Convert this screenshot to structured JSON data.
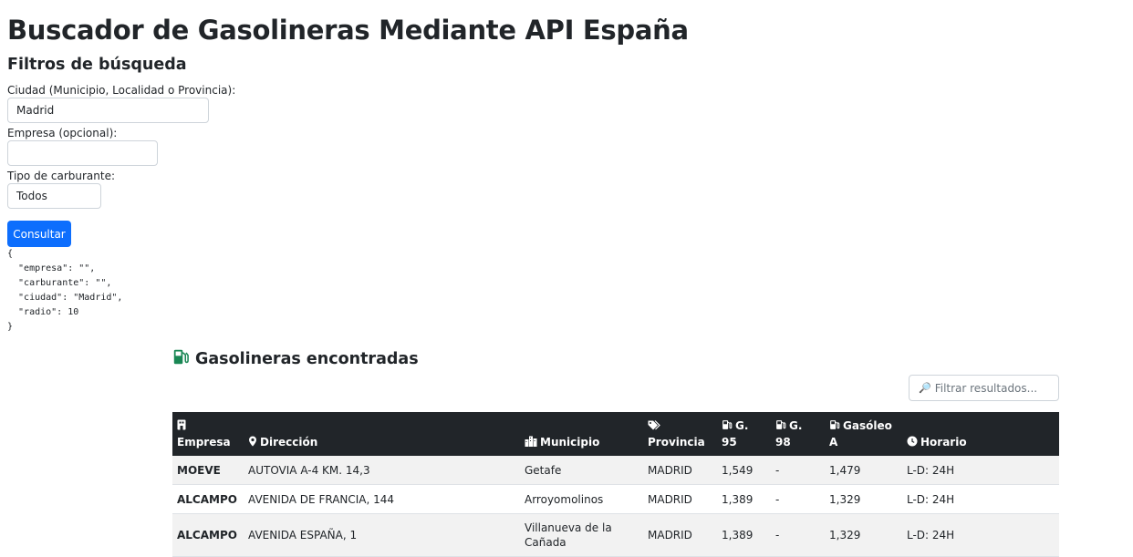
{
  "page_title": "Buscador de Gasolineras Mediante API España",
  "filters": {
    "title": "Filtros de búsqueda",
    "city_label": "Ciudad (Municipio, Localidad o Provincia):",
    "city_value": "Madrid",
    "company_label": "Empresa (opcional):",
    "company_value": "",
    "fuel_label": "Tipo de carburante:",
    "fuel_value": "Todos",
    "submit_label": "Consultar"
  },
  "request_json": "{\n  \"empresa\": \"\",\n  \"carburante\": \"\",\n  \"ciudad\": \"Madrid\",\n  \"radio\": 10\n}",
  "results": {
    "title": "Gasolineras encontradas",
    "filter_placeholder": "Filtrar resultados...",
    "columns": {
      "empresa": "Empresa",
      "direccion": "Dirección",
      "municipio": "Municipio",
      "provincia": "Provincia",
      "g95": "G. 95",
      "g98": "G. 98",
      "gasoleo": "Gasóleo A",
      "horario": "Horario"
    },
    "rows": [
      {
        "empresa": "MOEVE",
        "direccion": "AUTOVIA A-4 KM. 14,3",
        "municipio": "Getafe",
        "provincia": "MADRID",
        "g95": "1,549",
        "g98": "-",
        "gasoleo": "1,479",
        "horario": "L-D: 24H"
      },
      {
        "empresa": "ALCAMPO",
        "direccion": "AVENIDA DE FRANCIA, 144",
        "municipio": "Arroyomolinos",
        "provincia": "MADRID",
        "g95": "1,389",
        "g98": "-",
        "gasoleo": "1,329",
        "horario": "L-D: 24H"
      },
      {
        "empresa": "ALCAMPO",
        "direccion": "AVENIDA ESPAÑA, 1",
        "municipio": "Villanueva de la Cañada",
        "provincia": "MADRID",
        "g95": "1,389",
        "g98": "-",
        "gasoleo": "1,329",
        "horario": "L-D: 24H"
      }
    ]
  },
  "colors": {
    "primary": "#0d6efd",
    "table_header": "#212529",
    "fuel_icon": "#198754"
  },
  "icons": {
    "results": "fuel-pump-icon",
    "empresa": "building-icon",
    "direccion": "map-pin-icon",
    "municipio": "city-icon",
    "provincia": "tags-icon",
    "fuel": "fuel-pump-icon",
    "horario": "clock-icon",
    "filter": "magnifier-icon"
  }
}
